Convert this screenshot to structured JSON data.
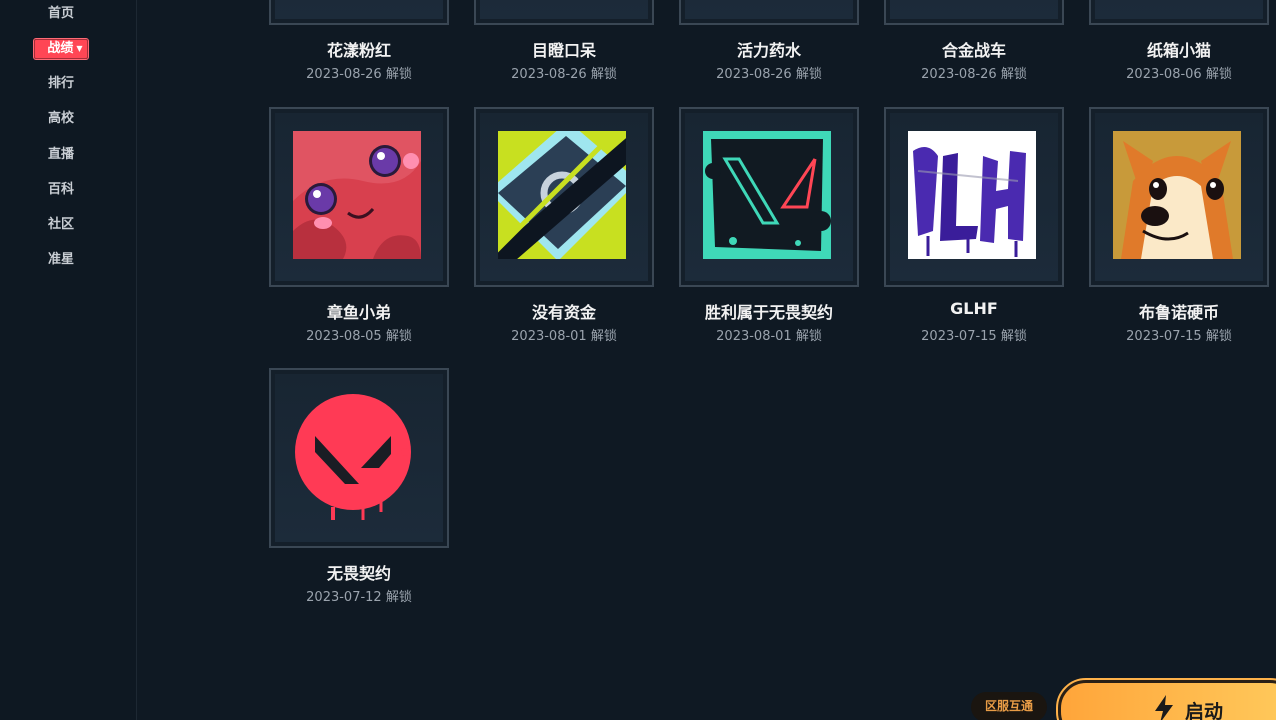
{
  "sidebar": {
    "items": [
      {
        "label": "首页"
      },
      {
        "label": "战绩"
      },
      {
        "label": "排行"
      },
      {
        "label": "高校"
      },
      {
        "label": "直播"
      },
      {
        "label": "百科"
      },
      {
        "label": "社区"
      },
      {
        "label": "准星"
      }
    ],
    "active_index": 1
  },
  "unlock_suffix": "解锁",
  "sprays": [
    {
      "title": "花漾粉红",
      "date": "2023-08-26 解锁"
    },
    {
      "title": "目瞪口呆",
      "date": "2023-08-26 解锁"
    },
    {
      "title": "活力药水",
      "date": "2023-08-26 解锁"
    },
    {
      "title": "合金战车",
      "date": "2023-08-26 解锁"
    },
    {
      "title": "纸箱小猫",
      "date": "2023-08-06 解锁"
    },
    {
      "title": "章鱼小弟",
      "date": "2023-08-05 解锁",
      "icon": "octopus-spray-icon"
    },
    {
      "title": "没有资金",
      "date": "2023-08-01 解锁",
      "icon": "no-funds-spray-icon"
    },
    {
      "title": "胜利属于无畏契约",
      "date": "2023-08-01 解锁",
      "icon": "valorant-victory-spray-icon"
    },
    {
      "title": "GLHF",
      "date": "2023-07-15 解锁",
      "icon": "glhf-graffiti-spray-icon"
    },
    {
      "title": "布鲁诺硬币",
      "date": "2023-07-15 解锁",
      "icon": "corgi-spray-icon"
    },
    {
      "title": "无畏契约",
      "date": "2023-07-12 解锁",
      "icon": "valorant-logo-spray-icon"
    }
  ],
  "footer": {
    "region_badge": "区服互通",
    "start_label": "启动"
  },
  "colors": {
    "background": "#0f1923",
    "accent_red": "#ff4655",
    "start_orange": "#ffa53a",
    "badge_text": "#e89c46"
  }
}
